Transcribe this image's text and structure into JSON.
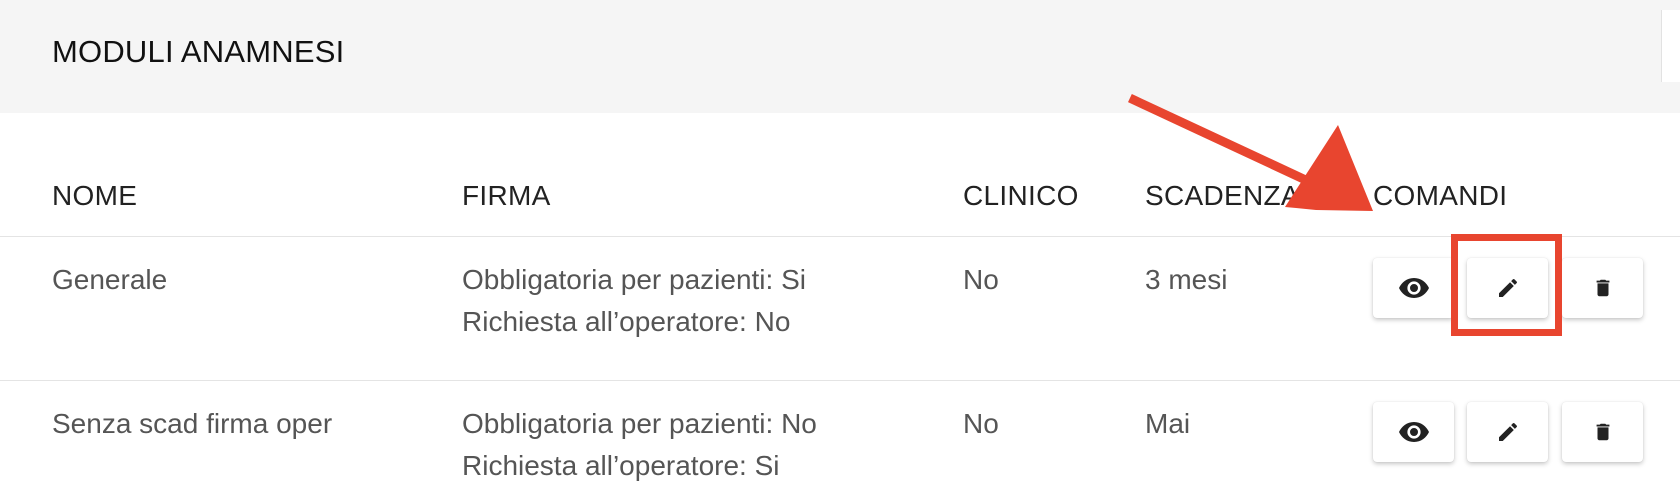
{
  "header": {
    "title": "MODULI ANAMNESI"
  },
  "table": {
    "columns": [
      "NOME",
      "FIRMA",
      "CLINICO",
      "SCADENZA",
      "COMANDI"
    ],
    "rows": [
      {
        "nome": "Generale",
        "firma_line1": "Obbligatoria per pazienti: Si",
        "firma_line2": "Richiesta all’operatore: No",
        "clinico": "No",
        "scadenza": "3 mesi"
      },
      {
        "nome": "Senza scad firma oper",
        "firma_line1": "Obbligatoria per pazienti: No",
        "firma_line2": "Richiesta all’operatore: Si",
        "clinico": "No",
        "scadenza": "Mai"
      }
    ]
  },
  "icons": {
    "view": "eye-icon",
    "edit": "pencil-icon",
    "delete": "trash-icon"
  },
  "colors": {
    "annotation": "#e8452f",
    "header_bg": "#f5f5f5",
    "icon": "#222222"
  }
}
